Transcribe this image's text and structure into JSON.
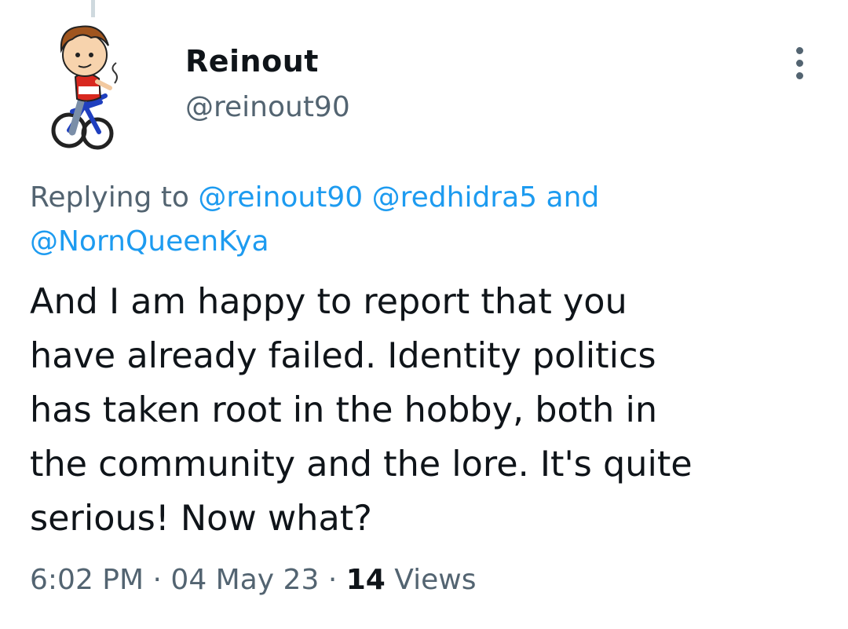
{
  "tweet": {
    "author": {
      "name": "Reinout",
      "handle": "@reinout90"
    },
    "reply_to": {
      "prefix": "Replying to",
      "mentions": [
        "@reinout90",
        "@redhidra5",
        "@NornQueenKya"
      ],
      "conjunction": "and"
    },
    "text": "And I am happy to report that you\nhave already failed. Identity politics\nhas taken root in the hobby, both in\nthe community and the lore. It's quite\nserious! Now what?",
    "time": "6:02 PM",
    "date": "04 May 23",
    "separator": "·",
    "views_count": "14",
    "views_label": "Views"
  },
  "icons": {
    "more": "more-vertical-icon"
  },
  "colors": {
    "link": "#1d9bf0",
    "secondary_text": "#536471",
    "primary_text": "#0f1419"
  }
}
